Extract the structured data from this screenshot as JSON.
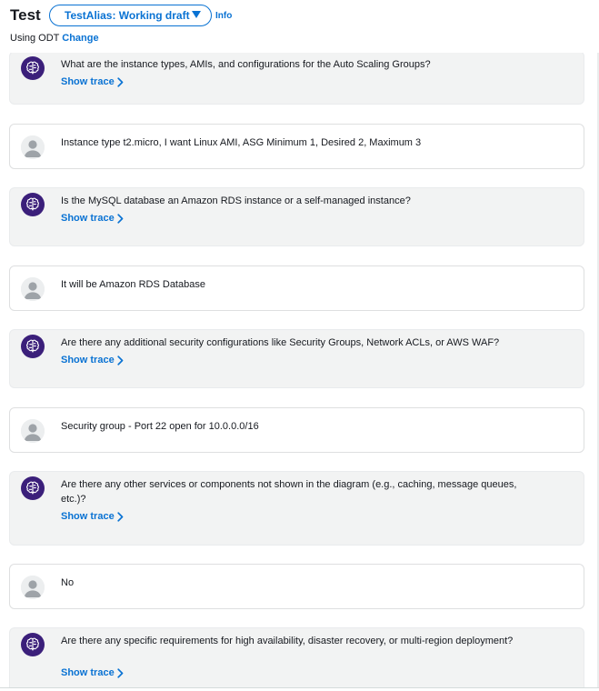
{
  "header": {
    "title": "Test",
    "alias_label": "TestAlias: Working draft",
    "info_label": "Info",
    "using_label": "Using ODT",
    "change_label": "Change"
  },
  "trace_label": "Show trace",
  "messages": [
    {
      "role": "agent",
      "text": "What are the instance types, AMIs, and configurations for the Auto Scaling Groups?"
    },
    {
      "role": "user",
      "text": "Instance type t2.micro, I want Linux AMI, ASG Minimum 1, Desired 2, Maximum 3"
    },
    {
      "role": "agent",
      "text": "Is the MySQL database an Amazon RDS instance or a self-managed instance?"
    },
    {
      "role": "user",
      "text": "It will be Amazon RDS Database"
    },
    {
      "role": "agent",
      "text": "Are there any additional security configurations like Security Groups, Network ACLs, or AWS WAF?"
    },
    {
      "role": "user",
      "text": "Security group - Port 22 open for 10.0.0.0/16"
    },
    {
      "role": "agent",
      "text": "Are there any other services or components not shown in the diagram (e.g., caching, message queues, etc.)?"
    },
    {
      "role": "user",
      "text": "No"
    },
    {
      "role": "agent",
      "text": "Are there any specific requirements for high availability, disaster recovery, or multi-region deployment?"
    }
  ],
  "colors": {
    "accent": "#0972d3",
    "agent_bubble": "#f2f3f3",
    "bot_avatar": "#3b1f7a"
  },
  "icons": {
    "bot_avatar": "brain-icon",
    "user_avatar": "person-icon",
    "trace": "chevron-right-icon",
    "alias_dropdown": "caret-down-icon"
  }
}
